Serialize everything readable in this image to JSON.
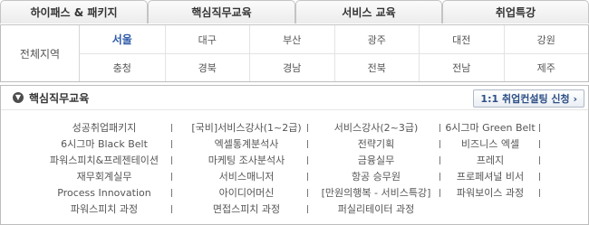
{
  "tabs": [
    "하이패스 & 패키지",
    "핵심직무교육",
    "서비스 교육",
    "취업특강"
  ],
  "regions": {
    "label": "전체지역",
    "row1": [
      "서울",
      "대구",
      "부산",
      "광주",
      "대전",
      "강원"
    ],
    "row2": [
      "충청",
      "경북",
      "경남",
      "전북",
      "전남",
      "제주"
    ],
    "active": "서울"
  },
  "section": {
    "title": "핵심직무교육",
    "icon": "chevron-down-icon",
    "consult_button": "1:1 취업컨설팅 신청 ›"
  },
  "courses": [
    [
      "성공취업패키지",
      "[국비]서비스강사(1~2급)",
      "서비스강사(2~3급)",
      "6시그마 Green Belt"
    ],
    [
      "6시그마 Black Belt",
      "엑셀통계분석사",
      "전략기획",
      "비즈니스 엑셀"
    ],
    [
      "파워스피치&프레젠테이션",
      "마케팅 조사분석사",
      "금융실무",
      "프레지"
    ],
    [
      "재무회계실무",
      "서비스매니저",
      "항공 승무원",
      "프로페셔널 비서"
    ],
    [
      "Process Innovation",
      "아이디어머신",
      "[만원의행복 - 서비스특강]",
      "파워보이스 과정"
    ],
    [
      "파워스피치 과정",
      "면접스피치 과정",
      "퍼실리테이터 과정",
      ""
    ]
  ],
  "colors": {
    "accent": "#2e5aa8",
    "border": "#bdbdbd",
    "text": "#555555"
  }
}
